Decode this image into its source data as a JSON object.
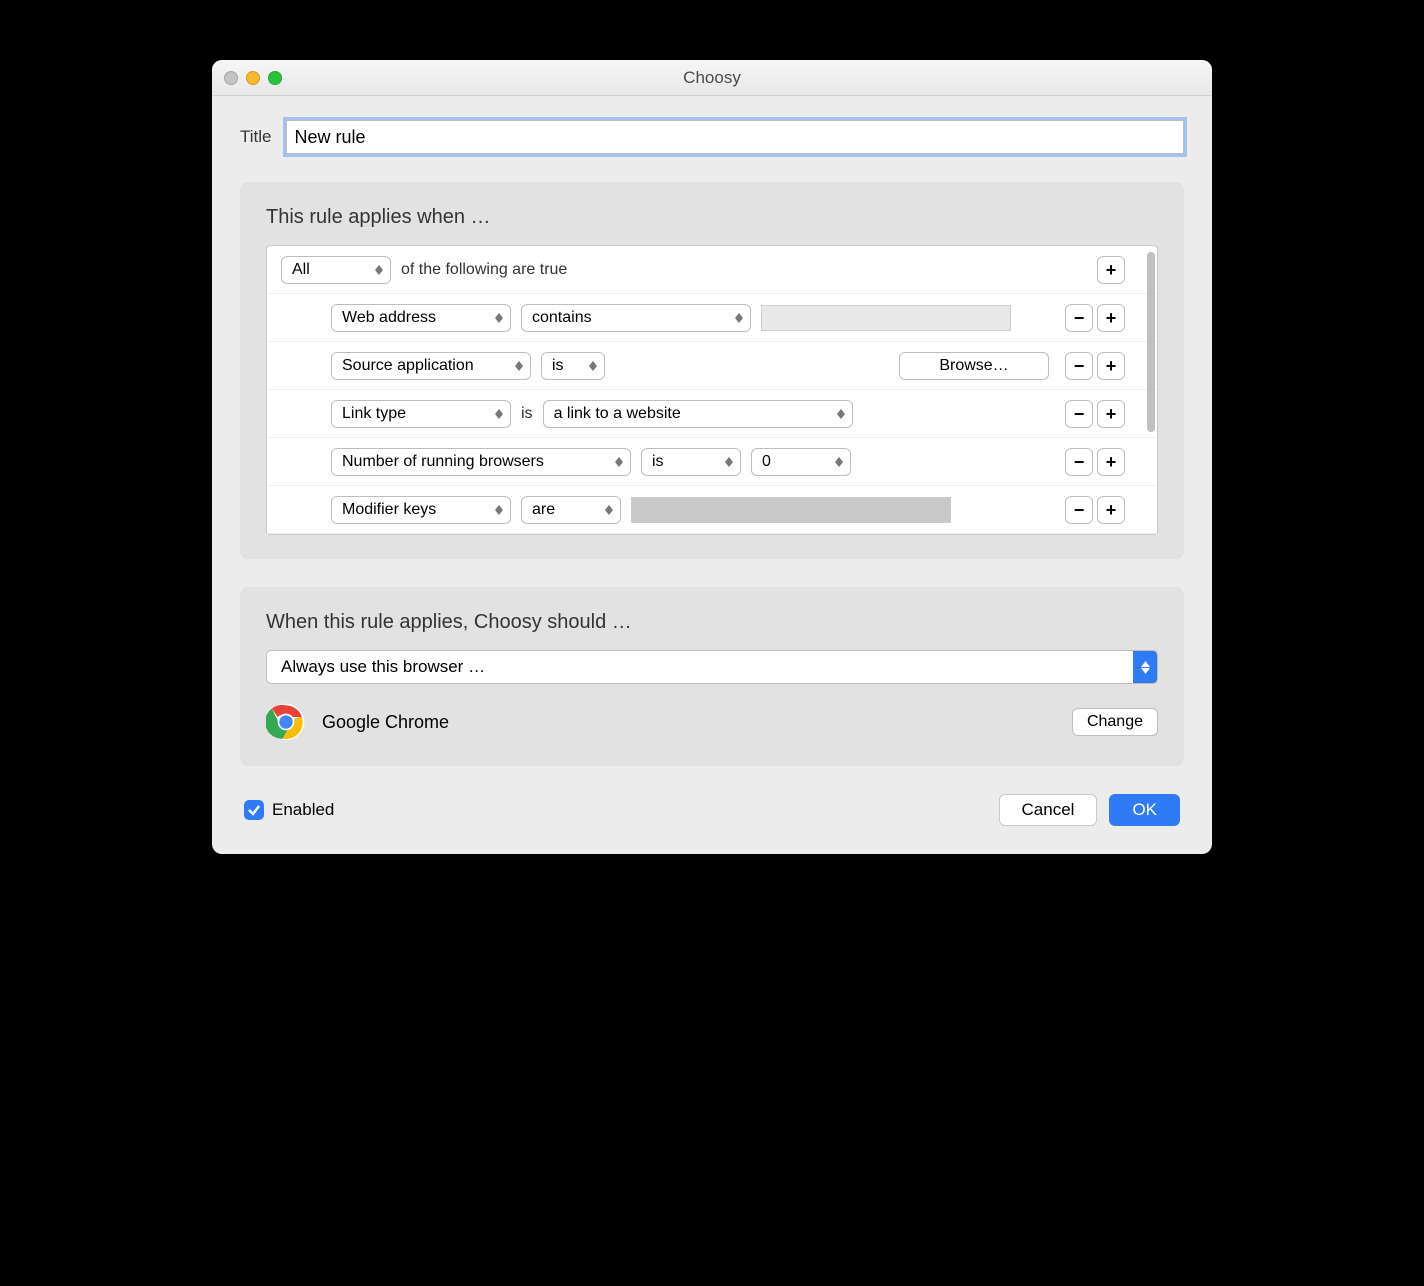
{
  "window": {
    "title": "Choosy"
  },
  "title_field": {
    "label": "Title",
    "value": "New rule"
  },
  "conditions": {
    "heading": "This rule applies when …",
    "top": {
      "quantifier": "All",
      "suffix": "of the following are true"
    },
    "rows": [
      {
        "field": "Web address",
        "op": "contains",
        "value": ""
      },
      {
        "field": "Source application",
        "op": "is",
        "browse": "Browse…"
      },
      {
        "field": "Link type",
        "op_static": "is",
        "value_select": "a link to a website"
      },
      {
        "field": "Number of running browsers",
        "op": "is",
        "num": "0"
      },
      {
        "field": "Modifier keys",
        "op": "are",
        "value": ""
      }
    ]
  },
  "action_panel": {
    "heading": "When this rule applies, Choosy should …",
    "action": "Always use this browser …",
    "browser": "Google Chrome",
    "change": "Change"
  },
  "footer": {
    "enabled_label": "Enabled",
    "cancel": "Cancel",
    "ok": "OK"
  }
}
